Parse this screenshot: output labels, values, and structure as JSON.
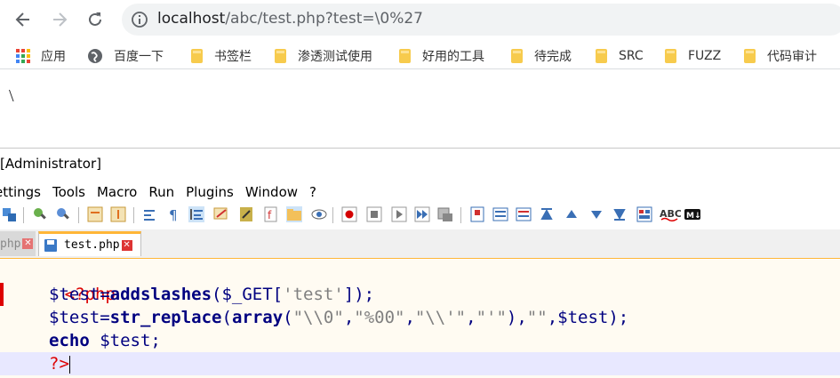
{
  "browser": {
    "url_host": "localhost",
    "url_path": "/abc/test.php?test=\\0%27",
    "bookmarks": [
      {
        "label": "应用",
        "icon": "apps-grid-icon"
      },
      {
        "label": "百度一下",
        "icon": "globe-icon"
      },
      {
        "label": "书签栏",
        "icon": "folder-icon"
      },
      {
        "label": "渗透测试使用",
        "icon": "folder-icon"
      },
      {
        "label": "好用的工具",
        "icon": "folder-icon"
      },
      {
        "label": "待完成",
        "icon": "folder-icon"
      },
      {
        "label": "SRC",
        "icon": "folder-icon"
      },
      {
        "label": "FUZZ",
        "icon": "folder-icon"
      },
      {
        "label": "代码审计",
        "icon": "folder-icon"
      }
    ],
    "page_output": "\\"
  },
  "editor": {
    "title": "[Administrator]",
    "menu": [
      "ettings",
      "Tools",
      "Macro",
      "Run",
      "Plugins",
      "Window",
      "?"
    ],
    "tabs": [
      {
        "label": "php",
        "active": false
      },
      {
        "label": "test.php",
        "active": true
      }
    ],
    "code": {
      "l1_open": "<?php",
      "l2_var": "$test",
      "l2_eq": "=",
      "l2_fn": "addslashes",
      "l2_args_open": "($_GET[",
      "l2_str": "'test'",
      "l2_close": "]);",
      "l3_var": "$test",
      "l3_eq": "=",
      "l3_fn": "str_replace",
      "l3_paren": "(",
      "l3_array": "array",
      "l3_arr_open": "(",
      "l3_s1": "\"\\\\0\"",
      "l3_c1": ",",
      "l3_s2": "\"%00\"",
      "l3_c2": ",",
      "l3_s3": "\"\\\\'\"",
      "l3_c3": ",",
      "l3_s4": "\"'\"",
      "l3_arr_close": "),",
      "l3_s5": "\"\"",
      "l3_c5": ",",
      "l3_var2": "$test",
      "l3_end": ");",
      "l4_kw": "echo",
      "l4_var": " $test;",
      "l5_close": "?>"
    }
  },
  "colors": {
    "php_tag": "#dd0000",
    "variable": "#000080",
    "string": "#808080",
    "current_line": "#e8e8ff",
    "tab_accent": "#ffb637"
  }
}
